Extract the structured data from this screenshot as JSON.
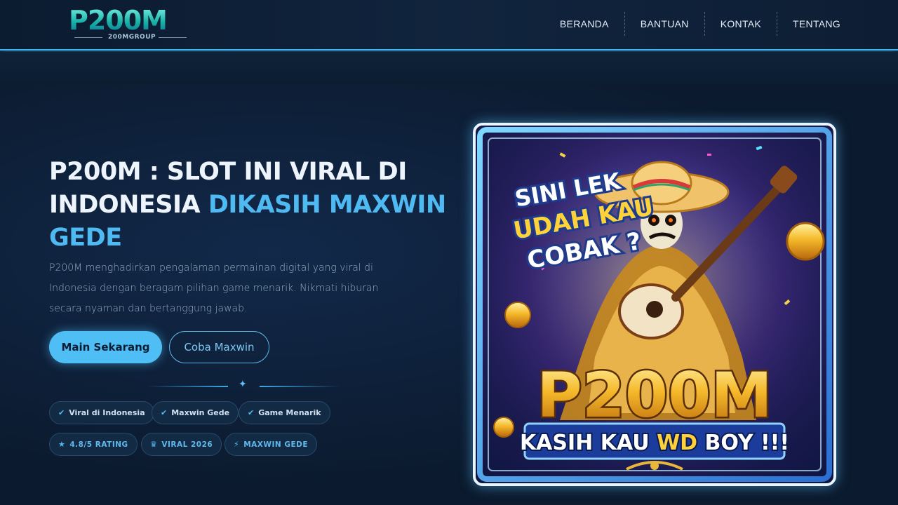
{
  "header": {
    "logo_text": "P200M",
    "logo_sub": "200MGROUP",
    "nav": [
      "BERANDA",
      "BANTUAN",
      "KONTAK",
      "TENTANG"
    ]
  },
  "hero": {
    "title_main": "P200M : SLOT INI VIRAL DI INDONESIA ",
    "title_highlight": "DIKASIH MAXWIN GEDE",
    "description": "P200M menghadirkan pengalaman permainan digital yang viral di Indonesia dengan beragam pilihan game menarik. Nikmati hiburan secara nyaman dan bertanggung jawab.",
    "primary_button": "Main Sekarang",
    "secondary_button": "Coba Maxwin",
    "features": [
      "Viral di Indonesia",
      "Maxwin Gede",
      "Game Menarik"
    ],
    "badges": [
      "4.8/5 RATING",
      "VIRAL 2026",
      "MAXWIN GEDE"
    ]
  },
  "banner": {
    "headline": "SINI LEK UDAH KAU COBAK ?",
    "brand": "P200M",
    "tagline_1": "KASIH KAU",
    "tagline_2": "WD",
    "tagline_3": "BOY !!!"
  },
  "colors": {
    "accent": "#4fb9f2",
    "background": "#0b1a2e"
  }
}
